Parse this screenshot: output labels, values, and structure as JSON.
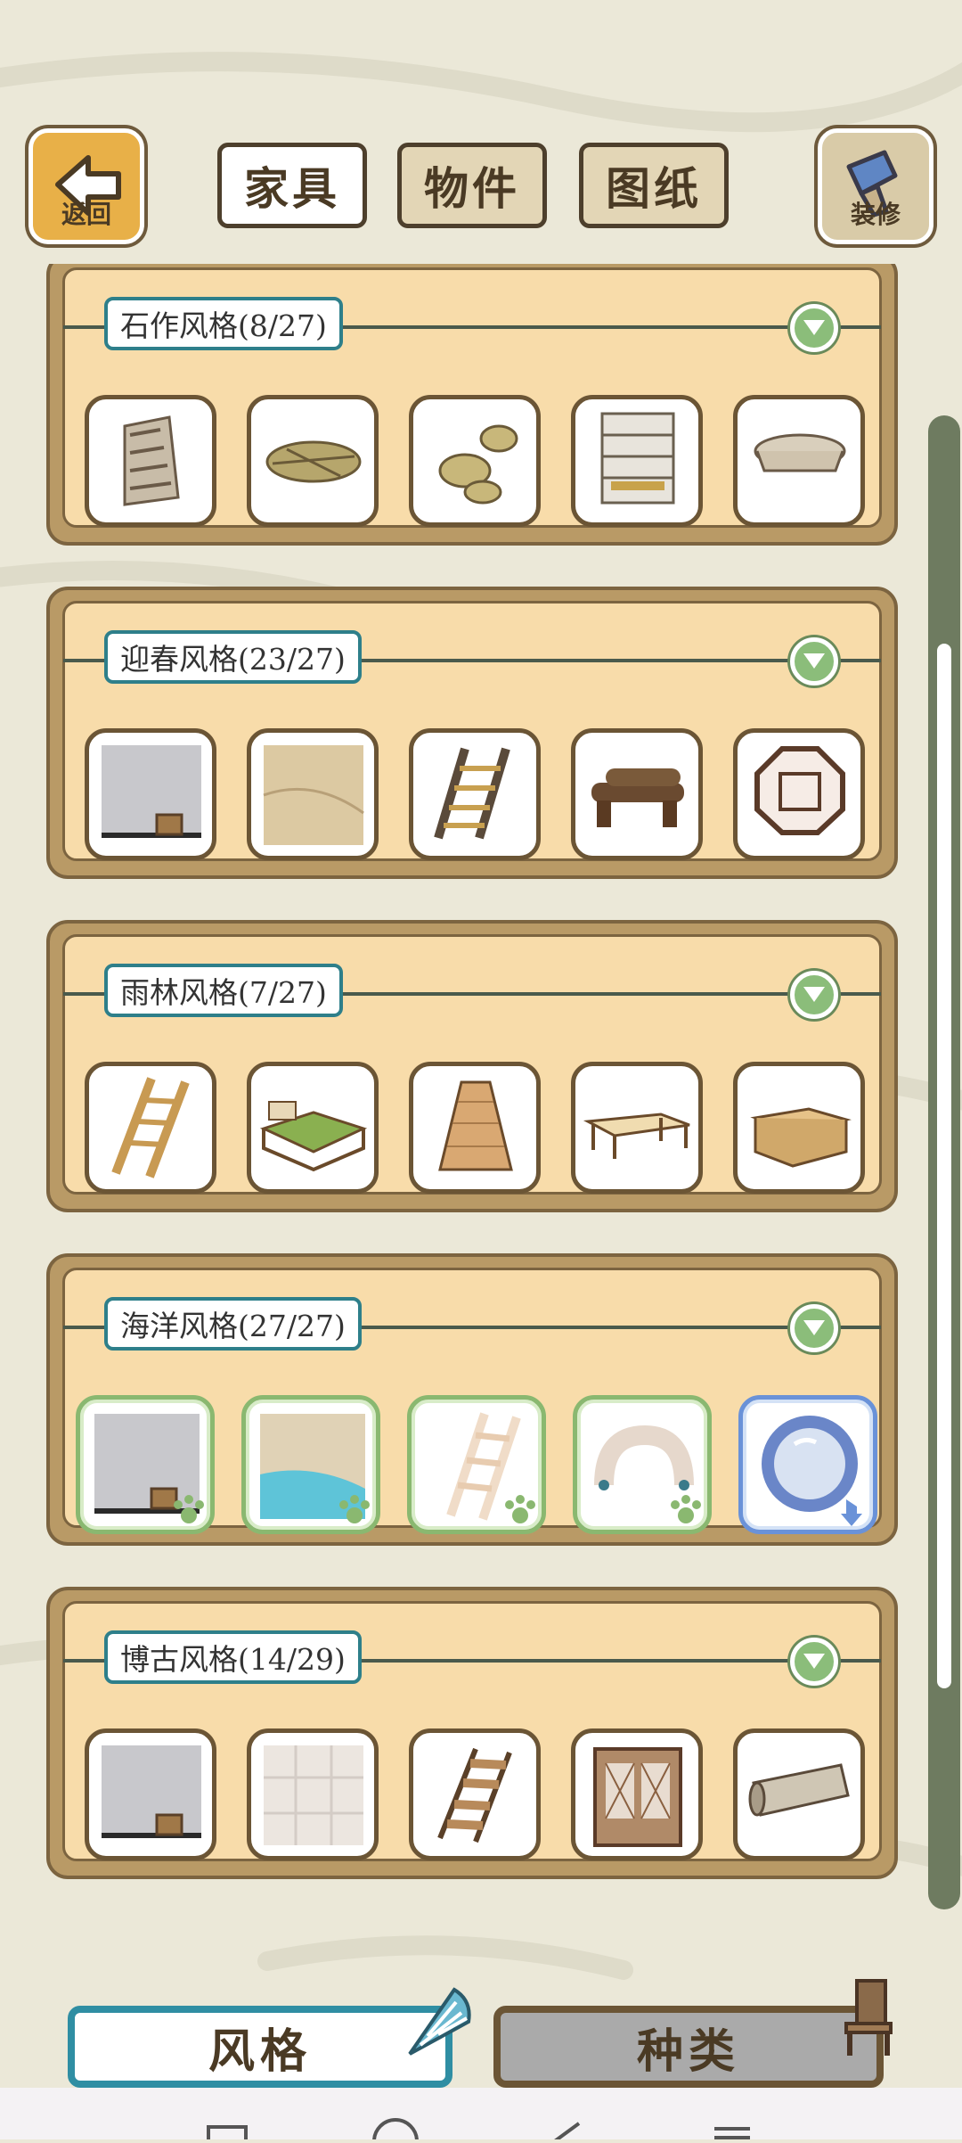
{
  "header": {
    "back_label": "返回",
    "decor_label": "装修",
    "tabs": [
      {
        "label": "家具",
        "active": true
      },
      {
        "label": "物件",
        "active": false
      },
      {
        "label": "图纸",
        "active": false
      }
    ]
  },
  "categories": [
    {
      "title": "石作风格(8/27)",
      "items": [
        "stone-stairs-icon",
        "leaf-bundle-icon",
        "leaf-pile-icon",
        "stone-shelf-icon",
        "stone-table-icon"
      ]
    },
    {
      "title": "迎春风格(23/27)",
      "items": [
        "wall-bucket-icon",
        "floor-panel-icon",
        "bamboo-ladder-icon",
        "log-bench-icon",
        "octagon-window-icon"
      ]
    },
    {
      "title": "雨林风格(7/27)",
      "items": [
        "wooden-ladder-icon",
        "green-bed-icon",
        "wicker-lamp-icon",
        "wooden-table-icon",
        "wooden-crate-icon"
      ]
    },
    {
      "title": "海洋风格(27/27)",
      "items": [
        "wall-bucket-icon",
        "sea-floor-icon",
        "white-ladder-icon",
        "coral-arch-icon",
        "porthole-icon"
      ]
    },
    {
      "title": "博古风格(14/29)",
      "items": [
        "wall-bucket-icon",
        "tile-floor-icon",
        "plank-stairs-icon",
        "lattice-door-icon",
        "scroll-icon"
      ]
    }
  ],
  "bottom_tabs": {
    "style_label": "风格",
    "kind_label": "种类",
    "active": "风格"
  },
  "colors": {
    "background": "#ebe8d8",
    "panel_outer": "#b99a66",
    "panel_inner": "#f8dcaa",
    "label_border": "#2e7f8a",
    "owned_green": "#8ab870",
    "owned_blue": "#6a92d8"
  }
}
